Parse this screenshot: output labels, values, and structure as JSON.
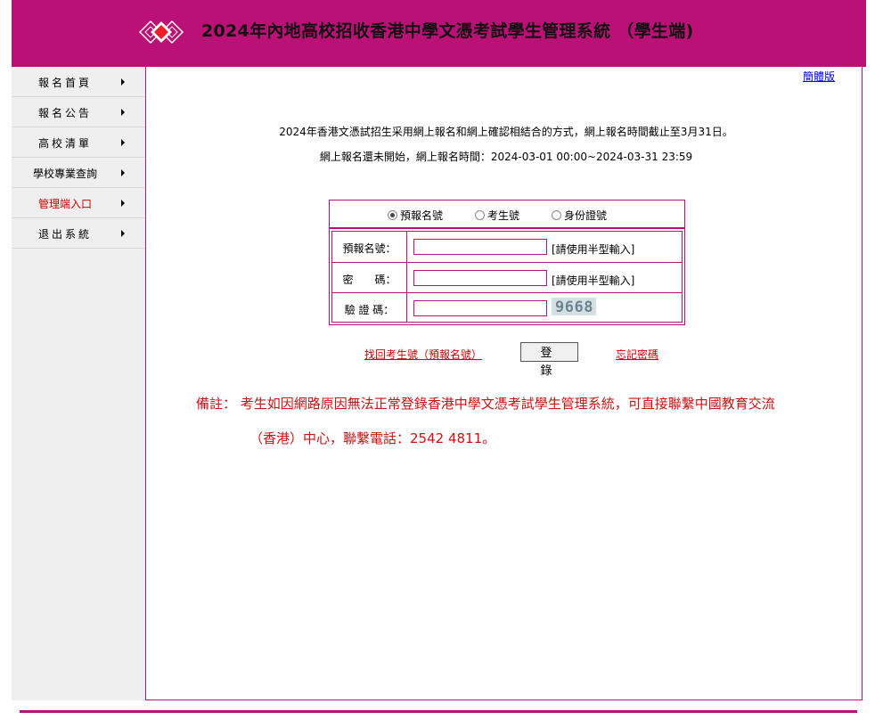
{
  "header": {
    "title": "2024年內地高校招收香港中學文憑考試學生管理系統 （學生端)",
    "brand_color": "#bb1177"
  },
  "sidebar": {
    "items": [
      {
        "label": "報名首頁"
      },
      {
        "label": "報名公告"
      },
      {
        "label": "高校清單"
      },
      {
        "label": "學校專業查詢"
      },
      {
        "label": "管理端入口"
      },
      {
        "label": "退出系統"
      }
    ]
  },
  "lang_link": "簡體版",
  "notices": [
    "2024年香港文憑試招生采用網上報名和網上確認相結合的方式，網上報名時間截止至3月31日。",
    "網上報名還未開始，網上報名時間：2024-03-01 00:00~2024-03-31 23:59"
  ],
  "login_type": {
    "options": [
      "預報名號",
      "考生號",
      "身份證號"
    ],
    "selected": "預報名號"
  },
  "form": {
    "prereg_label": "預報名號：",
    "password_label": "密　　碼：",
    "captcha_label": "驗 證 碼：",
    "halfwidth_hint": "[請使用半型輸入]",
    "prereg_value": "",
    "password_value": "",
    "captcha_value": "",
    "captcha_image_text": "9668"
  },
  "actions": {
    "recover_link": "找回考生號（預報名號）",
    "login_button": "登　錄",
    "forgot_link": "忘記密碼"
  },
  "remark": {
    "line1": "備註：  考生如因網路原因無法正常登錄香港中學文憑考試學生管理系統，可直接聯繫中國教育交流",
    "line2": "（香港）中心，聯繫電話：2542 4811。"
  }
}
